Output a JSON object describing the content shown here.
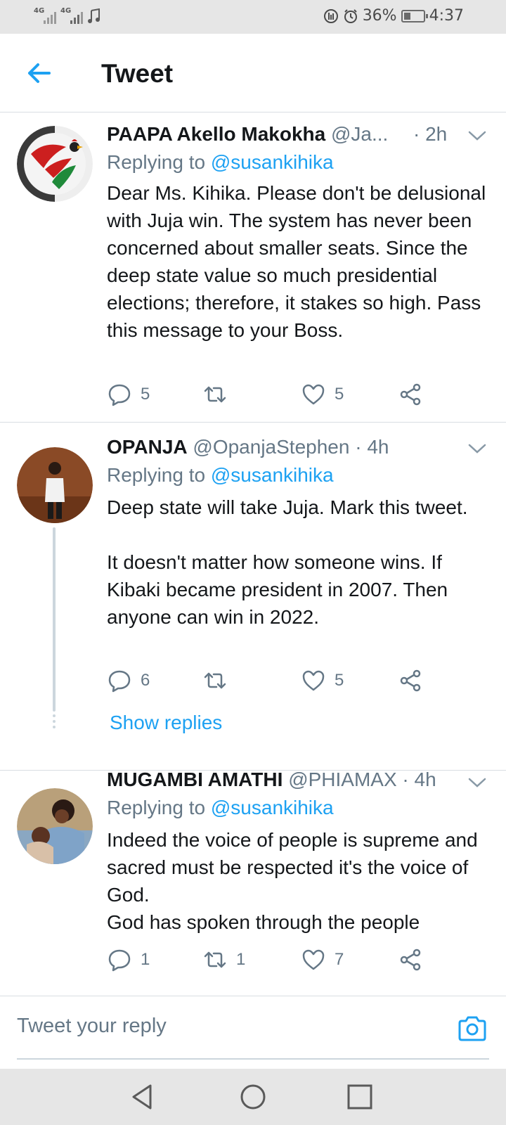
{
  "status_bar": {
    "signal1_label": "4G",
    "signal2_label": "4G",
    "battery_percent": "36%",
    "battery_level": 0.36,
    "time": "4:37"
  },
  "header": {
    "title": "Tweet",
    "back_icon": "arrow-left-icon"
  },
  "tweets": [
    {
      "name": "PAAPA Akello Makokha",
      "handle": "@Ja...",
      "time": "· 2h",
      "reply_prefix": "Replying to",
      "reply_mention": "@susankihika",
      "text": "Dear Ms. Kihika. Please don't be delusional with Juja win. The system has never been concerned about smaller seats. Since the deep state value so much presidential elections; therefore, it stakes so high. Pass this message to your Boss.",
      "replies": "5",
      "retweets": "",
      "likes": "5"
    },
    {
      "name": "OPANJA",
      "handle": "@OpanjaStephen",
      "time": "· 4h",
      "reply_prefix": "Replying to",
      "reply_mention": "@susankihika",
      "text": "Deep state will take Juja. Mark this tweet.\n\nIt doesn't matter how someone wins. If Kibaki became president in 2007. Then anyone can win in 2022.",
      "replies": "6",
      "retweets": "",
      "likes": "5",
      "show_replies": "Show replies"
    },
    {
      "name": "MUGAMBI AMATHI",
      "handle": "@PHIAMAX",
      "time": "· 4h",
      "reply_prefix": "Replying to",
      "reply_mention": "@susankihika",
      "text": "Indeed the voice of people is supreme and sacred must be respected it's the voice of God.\nGod has spoken through the people",
      "replies": "1",
      "retweets": "1",
      "likes": "7"
    }
  ],
  "reply_bar": {
    "placeholder": "Tweet your reply",
    "camera_icon": "camera-icon"
  },
  "colors": {
    "accent": "#1da1f2",
    "secondary_text": "#657786",
    "divider": "#d9dee2"
  }
}
